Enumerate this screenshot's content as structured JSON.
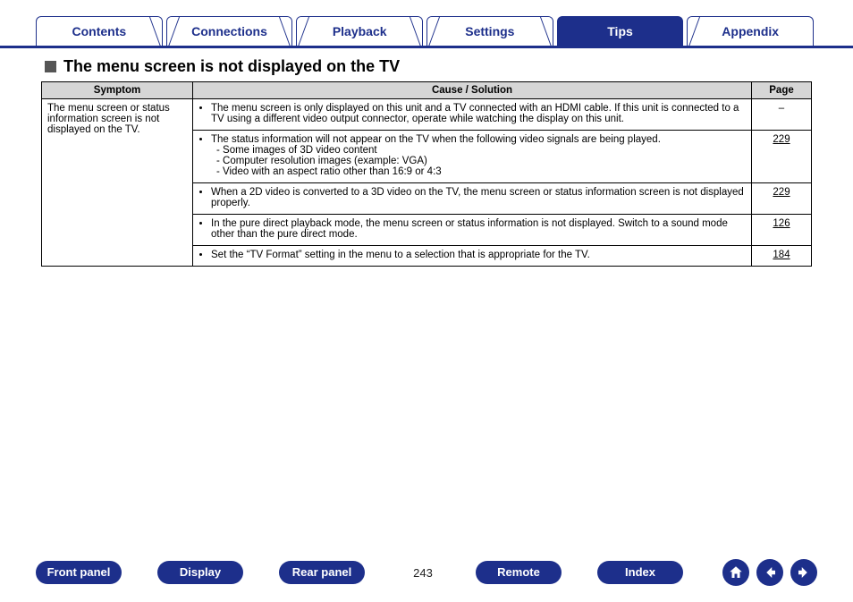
{
  "tabs": {
    "items": [
      {
        "label": "Contents"
      },
      {
        "label": "Connections"
      },
      {
        "label": "Playback"
      },
      {
        "label": "Settings"
      },
      {
        "label": "Tips",
        "active": true
      },
      {
        "label": "Appendix"
      }
    ]
  },
  "section_title": "The menu screen is not displayed on the TV",
  "table": {
    "headers": {
      "symptom": "Symptom",
      "cause": "Cause / Solution",
      "page": "Page"
    },
    "symptom": "The menu screen or status information screen is not displayed on the TV.",
    "rows": [
      {
        "solution": "The menu screen is only displayed on this unit and a TV connected with an HDMI cable. If this unit is connected to a TV using a different video output connector, operate while watching the display on this unit.",
        "page": "–"
      },
      {
        "solution": "The status information will not appear on the TV when the following video signals are being played.",
        "sub": [
          "- Some images of 3D video content",
          "- Computer resolution images (example: VGA)",
          "- Video with an aspect ratio other than 16:9 or 4:3"
        ],
        "page": "229"
      },
      {
        "solution": "When a 2D video is converted to a 3D video on the TV, the menu screen or status information screen is not displayed properly.",
        "page": "229"
      },
      {
        "solution": "In the pure direct playback mode, the menu screen or status information is not displayed. Switch to a sound mode other than the pure direct mode.",
        "page": "126"
      },
      {
        "solution": "Set the “TV Format” setting in the menu to a selection that is appropriate for the TV.",
        "page": "184"
      }
    ]
  },
  "bottom": {
    "buttons": [
      {
        "label": "Front panel"
      },
      {
        "label": "Display"
      },
      {
        "label": "Rear panel"
      }
    ],
    "page_number": "243",
    "buttons2": [
      {
        "label": "Remote"
      },
      {
        "label": "Index"
      }
    ]
  }
}
